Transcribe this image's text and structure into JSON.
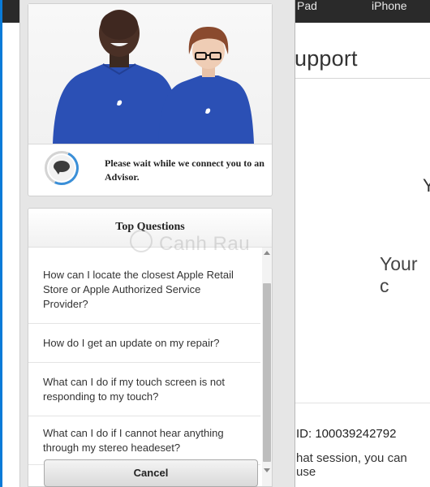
{
  "background_page": {
    "nav": {
      "ipad": "Pad",
      "iphone": "iPhone"
    },
    "title": "upport",
    "fragment_v": "Y",
    "fragment_your": "Your c",
    "session_id": "ID: 100039242792",
    "session_text": "hat session, you can use"
  },
  "chat": {
    "status_text": "Please wait while we connect you to an Advisor.",
    "questions_header": "Top Questions",
    "questions": [
      "How can I locate the closest Apple Retail Store or Apple Authorized Service Provider?",
      "How do I get an update on my repair?",
      "What can I do if my touch screen is not responding to my touch?",
      "What can I do if I cannot hear anything through my stereo headeset?"
    ],
    "cancel_label": "Cancel"
  },
  "watermark": "Canh Rau",
  "colors": {
    "accent_blue": "#0a7bd8",
    "shirt_blue": "#2b50b5",
    "nav_background": "#2a2a2a"
  }
}
